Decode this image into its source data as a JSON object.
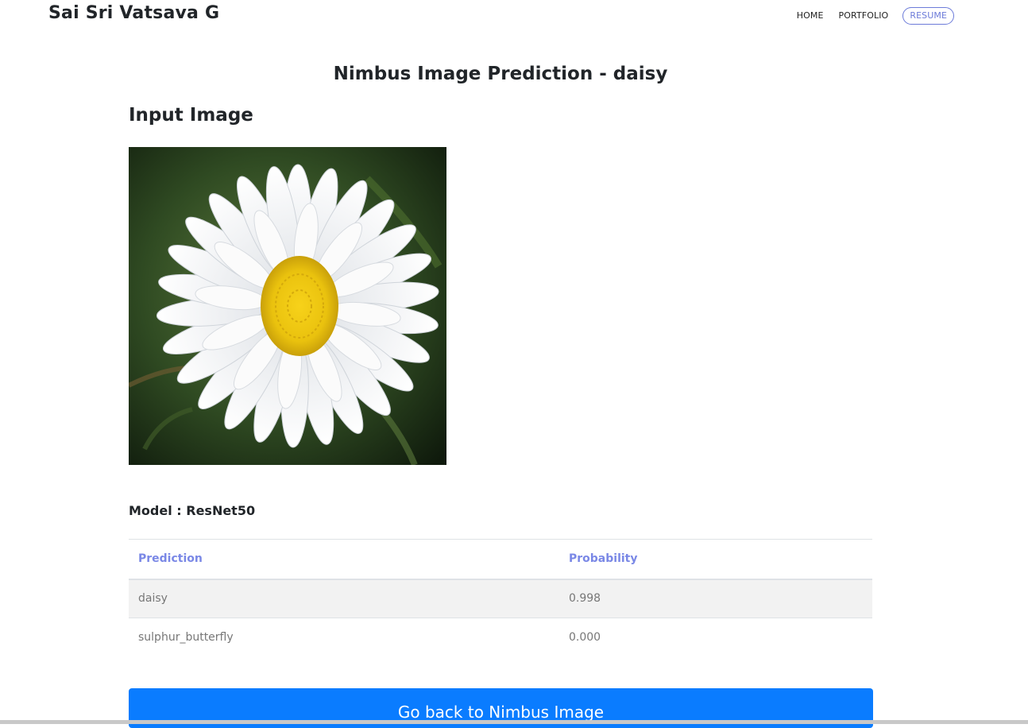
{
  "navbar": {
    "brand": "Sai Sri Vatsava G",
    "links": [
      {
        "label": "HOME"
      },
      {
        "label": "PORTFOLIO"
      },
      {
        "label": "RESUME"
      }
    ]
  },
  "main": {
    "page_title": "Nimbus Image Prediction - daisy",
    "input_section_title": "Input Image",
    "input_image": {
      "subject": "white daisy flower with yellow center on dark green background"
    },
    "model_label": "Model : ResNet50",
    "table": {
      "headers": [
        "Prediction",
        "Probability"
      ],
      "rows": [
        [
          "daisy",
          "0.998"
        ],
        [
          "sulphur_butterfly",
          "0.000"
        ]
      ]
    },
    "back_button_label": "Go back to Nimbus Image"
  },
  "colors": {
    "accent": "#7a88e6",
    "button": "#0a7cff",
    "stripe": "#f2f2f2"
  }
}
